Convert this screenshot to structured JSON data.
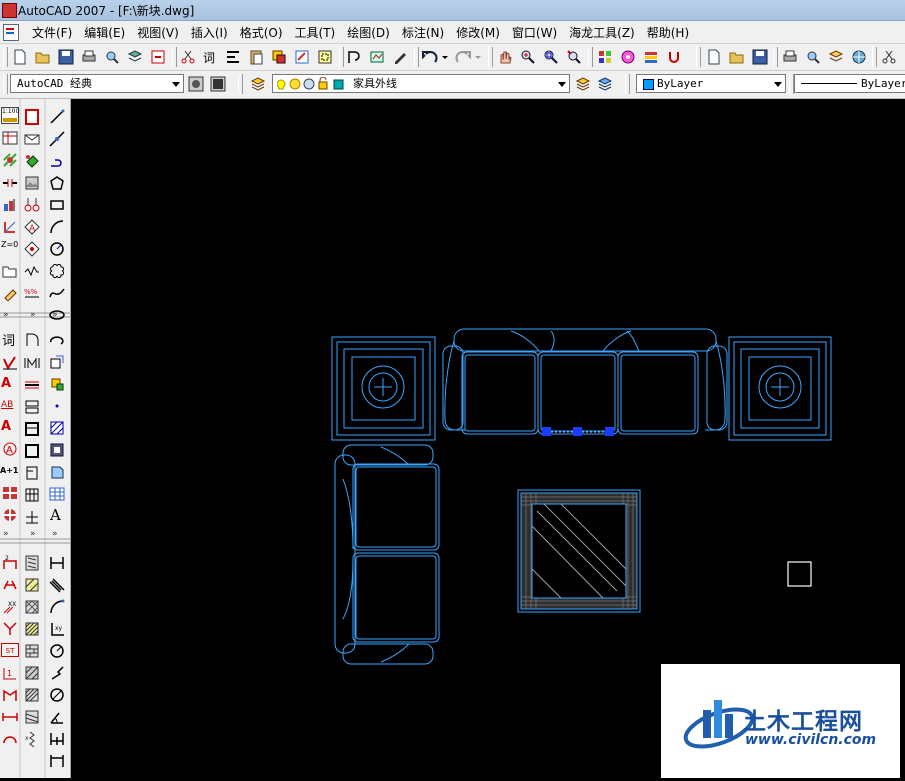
{
  "window": {
    "title": "AutoCAD 2007 - [F:\\新块.dwg]"
  },
  "menu": [
    "文件(F)",
    "编辑(E)",
    "视图(V)",
    "插入(I)",
    "格式(O)",
    "工具(T)",
    "绘图(D)",
    "标注(N)",
    "修改(M)",
    "窗口(W)",
    "海龙工具(Z)",
    "帮助(H)"
  ],
  "workspace": {
    "value": "AutoCAD 经典"
  },
  "layer": {
    "value": "家具外线",
    "color": "#00aaaa"
  },
  "color_control": {
    "value": "ByLayer",
    "swatch": "#00a0ff"
  },
  "linetype_control": {
    "value": "ByLayer"
  },
  "left_labels": {
    "scale": "1:100",
    "word": "词",
    "letter": "A",
    "ab": "AB",
    "a1": "A+1",
    "st": "ST",
    "zoom": "Z=0"
  },
  "colors": {
    "furniture": "#3aa6ff",
    "grips": "#1a3cff",
    "background": "#000000"
  },
  "watermark": {
    "name": "土木工程网",
    "url": "www.civilcn.com"
  }
}
